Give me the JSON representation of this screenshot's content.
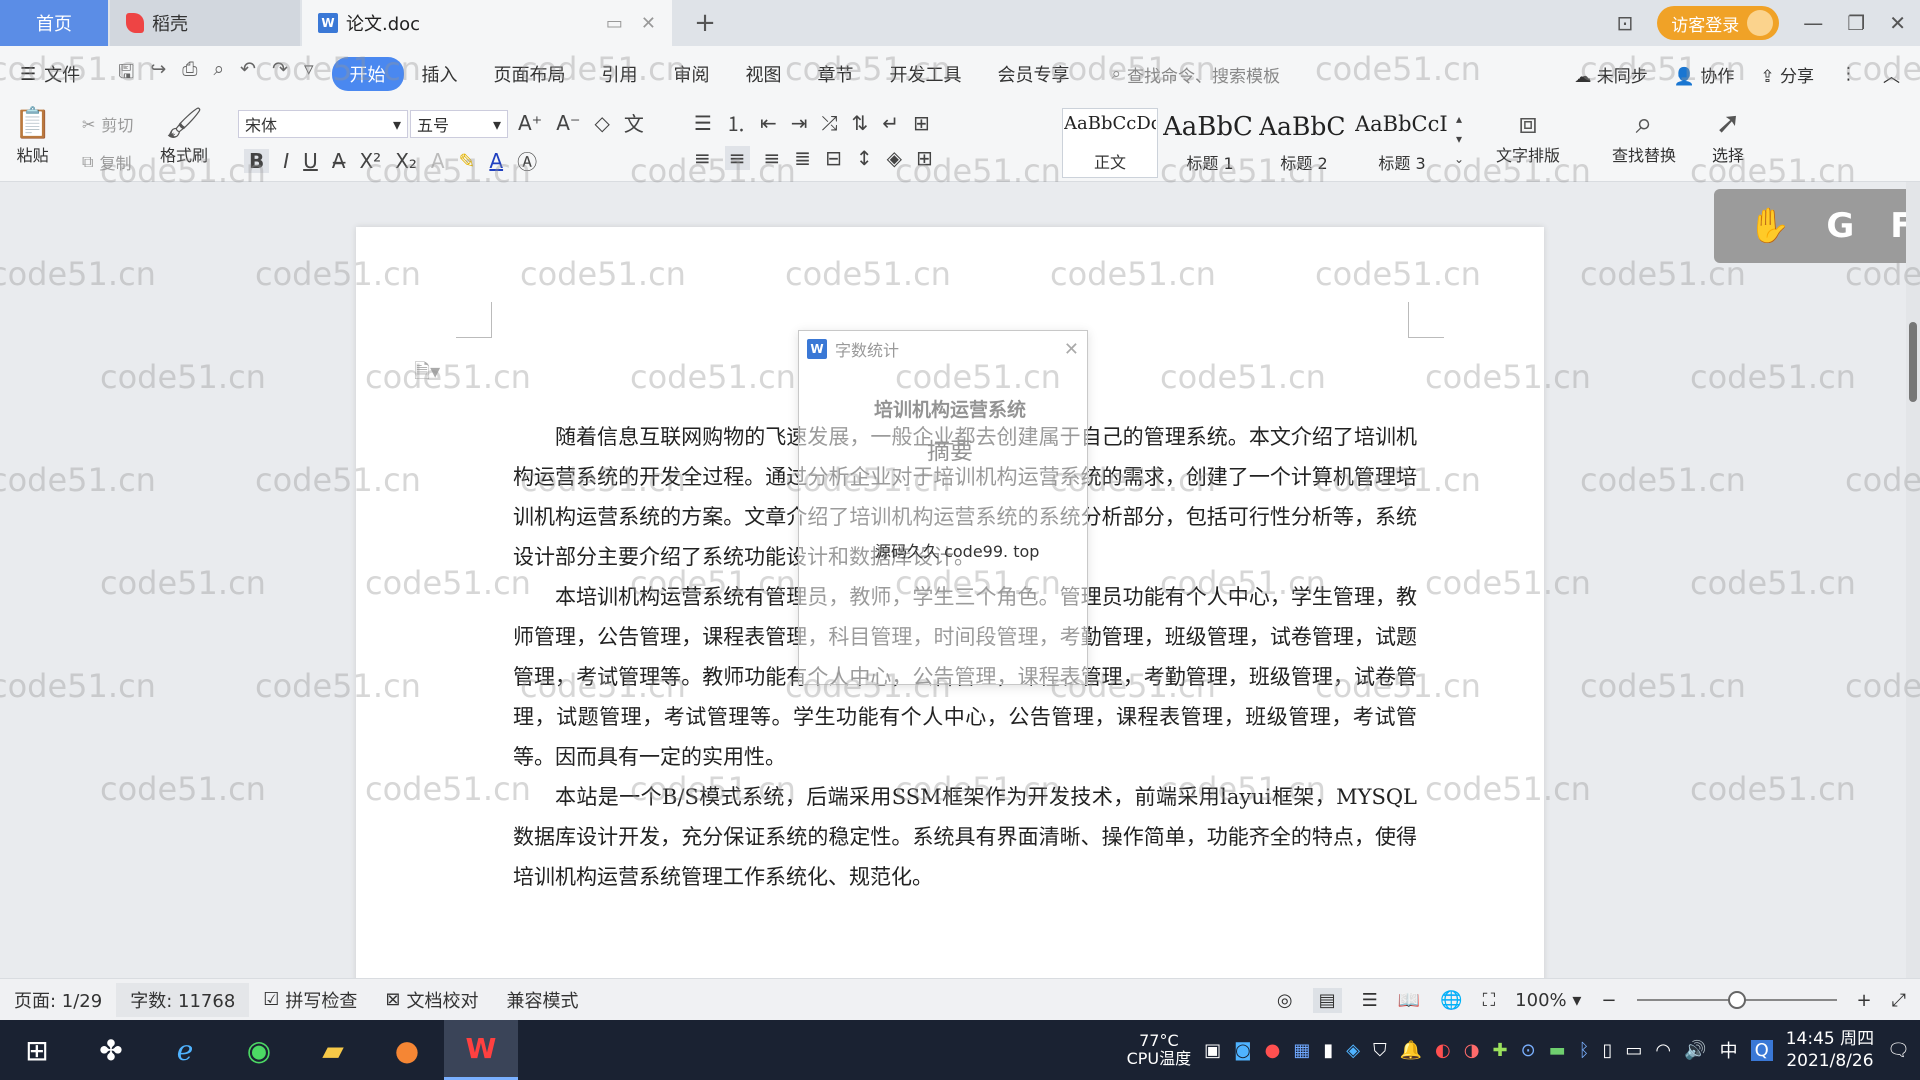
{
  "tabs": {
    "home": "首页",
    "docer": "稻壳",
    "doc": "论文.doc",
    "new": "+"
  },
  "account": {
    "login": "访客登录"
  },
  "menu": {
    "file": "文件",
    "tabs": [
      "开始",
      "插入",
      "页面布局",
      "引用",
      "审阅",
      "视图",
      "章节",
      "开发工具",
      "会员专享"
    ],
    "search_placeholder": "查找命令、搜索模板",
    "sync": "未同步",
    "collab": "协作",
    "share": "分享"
  },
  "ribbon": {
    "paste": "粘贴",
    "cut": "剪切",
    "copy": "复制",
    "format_painter": "格式刷",
    "font_name": "宋体",
    "font_size": "五号",
    "styles": [
      {
        "sample": "AaBbCcDd",
        "label": "正文"
      },
      {
        "sample": "AaBbC",
        "label": "标题 1"
      },
      {
        "sample": "AaBbC",
        "label": "标题 2"
      },
      {
        "sample": "AaBbCcI",
        "label": "标题 3"
      }
    ],
    "text_layout": "文字排版",
    "find_replace": "查找替换",
    "select": "选择"
  },
  "floating_panel": {
    "letters": [
      "G",
      "F"
    ]
  },
  "dialog": {
    "title": "字数统计",
    "overlay_text": "源码久久 code99. top"
  },
  "document": {
    "title": "培训机构运营系统",
    "subtitle": "摘要",
    "paragraphs": [
      "随着信息互联网购物的飞速发展，一般企业都去创建属于自己的管理系统。本文介绍了培训机构运营系统的开发全过程。通过分析企业对于培训机构运营系统的需求，创建了一个计算机管理培训机构运营系统的方案。文章介绍了培训机构运营系统的系统分析部分，包括可行性分析等，系统设计部分主要介绍了系统功能设计和数据库设计。",
      "本培训机构运营系统有管理员，教师，学生三个角色。管理员功能有个人中心，学生管理，教师管理，公告管理，课程表管理，科目管理，时间段管理，考勤管理，班级管理，试卷管理，试题管理，考试管理等。教师功能有个人中心，公告管理，课程表管理，考勤管理，班级管理，试卷管理，试题管理，考试管理等。学生功能有个人中心，公告管理，课程表管理，班级管理，考试管等。因而具有一定的实用性。",
      "本站是一个B/S模式系统，后端采用SSM框架作为开发技术，前端采用layui框架，MYSQL数据库设计开发，充分保证系统的稳定性。系统具有界面清晰、操作简单，功能齐全的特点，使得培训机构运营系统管理工作系统化、规范化。"
    ]
  },
  "watermark": "code51.cn",
  "statusbar": {
    "page": "页面: 1/29",
    "words": "字数: 11768",
    "spell_check": "拼写检查",
    "proofread": "文档校对",
    "compat": "兼容模式",
    "zoom": "100%",
    "zoom_level": 0.5
  },
  "taskbar": {
    "temp": "77°C",
    "cpu": "CPU温度",
    "ime": "中",
    "time": "14:45 周四",
    "date": "2021/8/26"
  },
  "colors": {
    "accent": "#4a88f0",
    "home_tab": "#5b8de6",
    "login": "#f0a227",
    "taskbar": "#1a2232"
  }
}
